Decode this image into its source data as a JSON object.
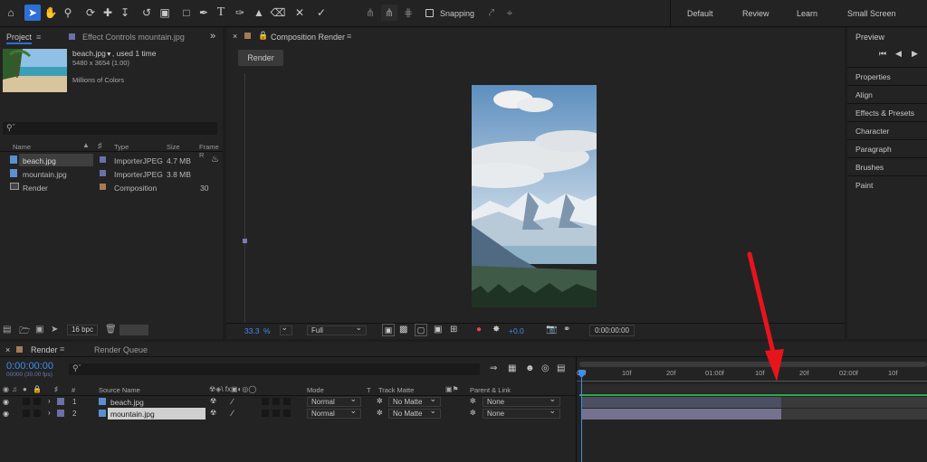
{
  "workspaces": [
    "Default",
    "Review",
    "Learn",
    "Small Screen"
  ],
  "toolbar": {
    "snapping_label": "Snapping"
  },
  "project": {
    "tab": "Project",
    "tab2": "Effect Controls mountain.jpg",
    "selected_name": "beach.jpg",
    "selected_used": ", used 1 time",
    "selected_dims": "5480 x 3654 (1.00)",
    "selected_colors": "Millions of Colors",
    "search_placeholder": "",
    "columns": {
      "name": "Name",
      "type": "Type",
      "size": "Size",
      "frame": "Frame R"
    },
    "items": [
      {
        "name": "beach.jpg",
        "type": "ImporterJPEG",
        "size": "4.7 MB",
        "frame": ""
      },
      {
        "name": "mountain.jpg",
        "type": "ImporterJPEG",
        "size": "3.8 MB",
        "frame": ""
      },
      {
        "name": "Render",
        "type": "Composition",
        "size": "",
        "frame": "30"
      }
    ],
    "bpc": "16 bpc"
  },
  "comp": {
    "tab": "Composition Render",
    "render_button": "Render",
    "zoom": "33.3",
    "zoom_unit": "%",
    "resolution": "Full",
    "exposure": "+0.0",
    "timecode": "0:00:00:00"
  },
  "right": {
    "preview": "Preview",
    "items": [
      "Properties",
      "Align",
      "Effects & Presets",
      "Character",
      "Paragraph",
      "Brushes",
      "Paint"
    ]
  },
  "timeline": {
    "tab": "Render",
    "tab2": "Render Queue",
    "timecode": "0:00:00:00",
    "frames": "00000 (30.00 fps)",
    "columns": {
      "source": "Source Name",
      "mode": "Mode",
      "t": "T",
      "track": "Track Matte",
      "parent": "Parent & Link",
      "num": "#"
    },
    "layers": [
      {
        "num": "1",
        "name": "beach.jpg",
        "mode": "Normal",
        "matte": "No Matte",
        "parent": "None"
      },
      {
        "num": "2",
        "name": "mountain.jpg",
        "mode": "Normal",
        "matte": "No Matte",
        "parent": "None"
      }
    ],
    "ruler": [
      "00f",
      "10f",
      "20f",
      "01:00f",
      "10f",
      "20f",
      "02:00f",
      "10f"
    ]
  },
  "colors": {
    "accent": "#2d6fd6",
    "timecode_blue": "#3d8ef0",
    "arrow": "#e8141b",
    "green_bar": "#2ea84a"
  }
}
